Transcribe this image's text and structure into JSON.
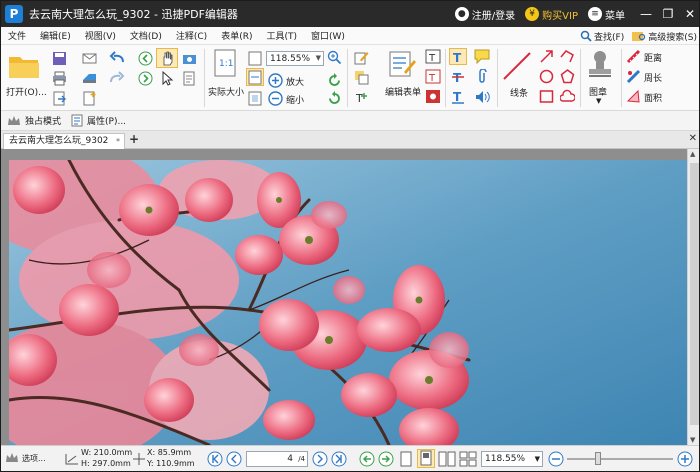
{
  "title": {
    "doc": "去云南大理怎么玩_9302",
    "sep": "-",
    "app": "迅捷PDF编辑器"
  },
  "title_right": {
    "login": "注册/登录",
    "vip": "购买VIP",
    "menu": "菜单"
  },
  "window_controls": {
    "minimize": "—",
    "maximize": "❐",
    "close": "✕"
  },
  "menu": [
    "文件",
    "编辑(E)",
    "视图(V)",
    "文档(D)",
    "注释(C)",
    "表单(R)",
    "工具(T)",
    "窗口(W)"
  ],
  "menu_right": {
    "find": "查找(F)",
    "adv_search": "高级搜索(S)"
  },
  "ribbon": {
    "open": "打开(O)...",
    "zoom_value": "118.55%",
    "actual_size": "实际大小",
    "zoom_in": "放大",
    "zoom_out": "缩小",
    "edit_form": "编辑表单",
    "line": "线条",
    "stamp": "图章",
    "distance": "距离",
    "perimeter": "周长",
    "area": "面积"
  },
  "secondary": {
    "exclusive": "独占模式",
    "properties": "属性(P)..."
  },
  "tab": {
    "label": "去云南大理怎么玩_9302",
    "modified": "*",
    "close": "✕",
    "new": "+"
  },
  "status": {
    "options": "选项...",
    "w": "W: 210.0mm",
    "h": "H: 297.0mm",
    "x": "X:    85.9mm",
    "y": "Y:  110.9mm",
    "page": "4",
    "pages": "/4",
    "zoom": "118.55%"
  },
  "colors": {
    "titlebar": "#2a2a2a",
    "accent": "#1e7fd6",
    "sky": "#5d9cc1",
    "blossom": "#e8576e"
  },
  "icons": [
    "folder-icon",
    "save-icon",
    "print-icon",
    "email-icon",
    "undo-icon",
    "redo-icon",
    "hand-icon",
    "select-icon",
    "camera-icon",
    "zoom-in-icon",
    "zoom-out-icon",
    "rotate-icon",
    "text-icon",
    "note-icon",
    "clip-icon",
    "sound-icon",
    "line-icon",
    "arrow-icon",
    "circle-icon",
    "polygon-icon",
    "rect-icon",
    "cloud-icon",
    "stamp-icon",
    "ruler-icon",
    "search-icon",
    "binoculars-icon"
  ]
}
